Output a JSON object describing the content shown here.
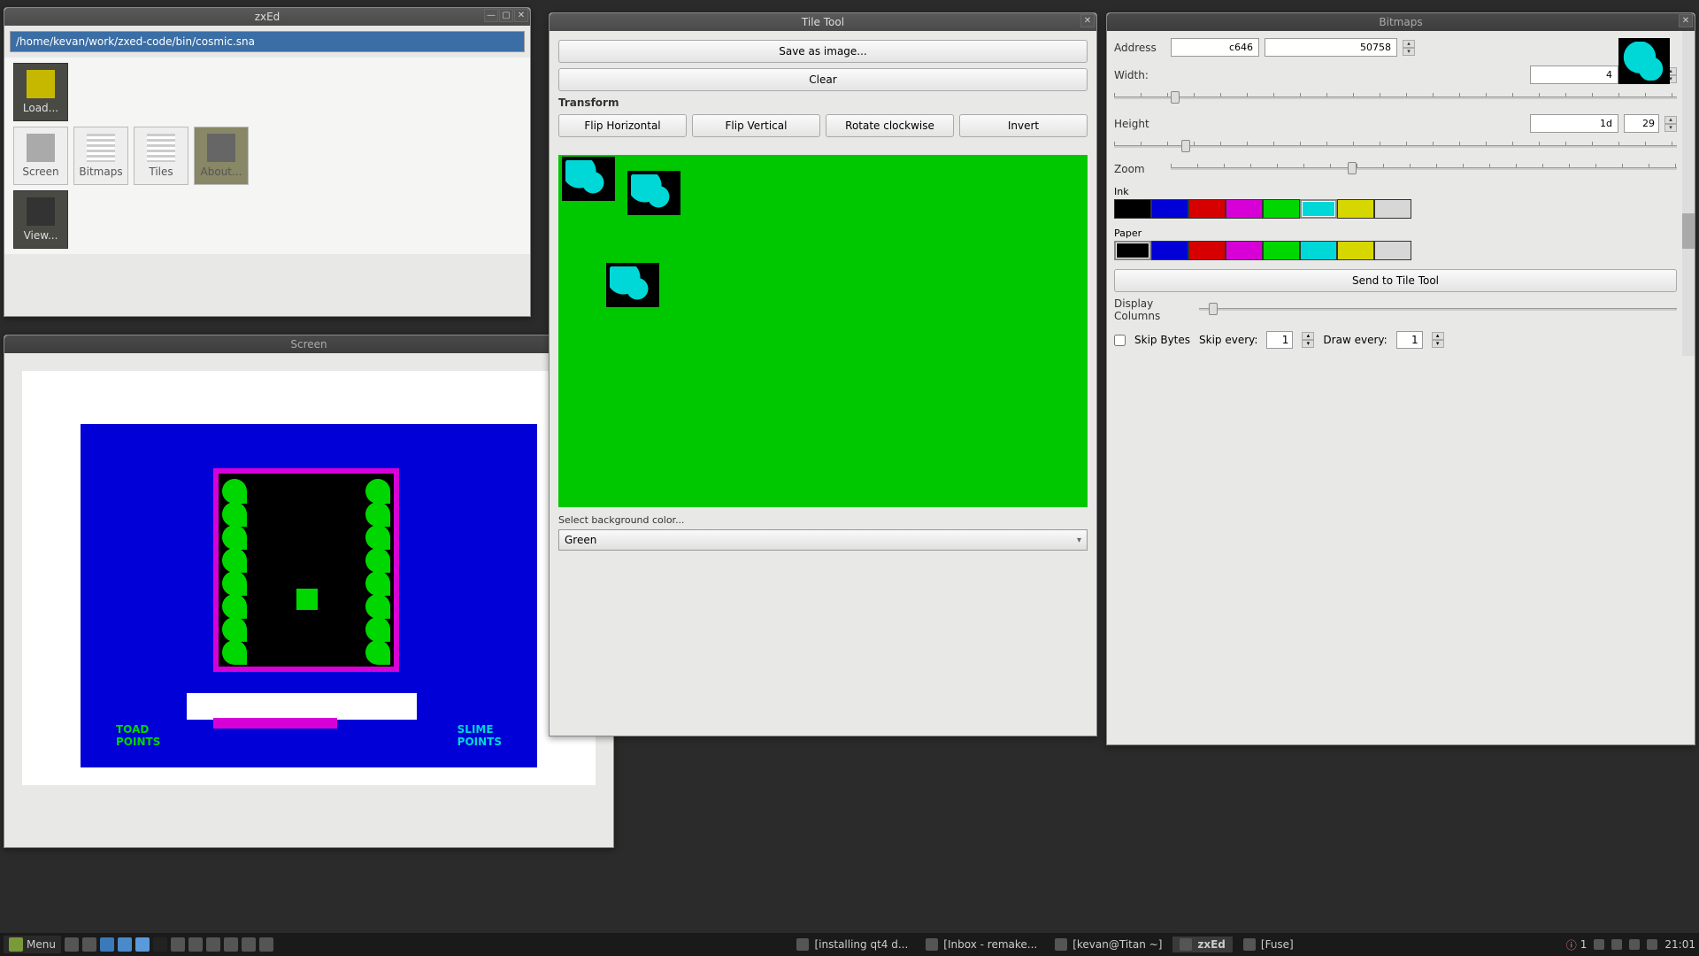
{
  "zxed": {
    "title": "zxEd",
    "path": "/home/kevan/work/zxed-code/bin/cosmic.sna",
    "tools": [
      {
        "label": "Load...",
        "dark": true,
        "yellow": true
      },
      {
        "label": "Screen"
      },
      {
        "label": "Bitmaps"
      },
      {
        "label": "Tiles"
      },
      {
        "label": "About...",
        "sel": true
      },
      {
        "label": "View...",
        "dark": true
      }
    ]
  },
  "screen": {
    "title": "Screen",
    "left_label": "TOAD\nPOINTS",
    "right_label": "SLIME\nPOINTS"
  },
  "tiletool": {
    "title": "Tile Tool",
    "save_btn": "Save as image...",
    "clear_btn": "Clear",
    "transform_label": "Transform",
    "flip_h": "Flip Horizontal",
    "flip_v": "Flip Vertical",
    "rotate": "Rotate clockwise",
    "invert": "Invert",
    "bg_label": "Select background color...",
    "bg_value": "Green"
  },
  "bitmaps": {
    "title": "Bitmaps",
    "address_label": "Address",
    "address_hex": "c646",
    "address_dec": "50758",
    "width_label": "Width:",
    "width_hex": "4",
    "width_dec": "4",
    "height_label": "Height",
    "height_hex": "1d",
    "height_dec": "29",
    "zoom_label": "Zoom",
    "ink_label": "Ink",
    "paper_label": "Paper",
    "send_btn": "Send to Tile Tool",
    "disp_cols_label": "Display Columns",
    "skip_bytes_label": "Skip Bytes",
    "skip_every_label": "Skip every:",
    "skip_every_val": "1",
    "draw_every_label": "Draw every:",
    "draw_every_val": "1",
    "palette": [
      "#000000",
      "#0000d7",
      "#d70000",
      "#d700d7",
      "#00d700",
      "#00d7d7",
      "#d7d700",
      "#d7d7d7"
    ],
    "ink_selected": 5,
    "paper_selected": 0
  },
  "taskbar": {
    "menu": "Menu",
    "notif_count": "1",
    "tasks": [
      {
        "label": "[installing qt4 d...",
        "active": false
      },
      {
        "label": "[Inbox - remake...",
        "active": false
      },
      {
        "label": "[kevan@Titan ~]",
        "active": false
      },
      {
        "label": "zxEd",
        "active": true
      },
      {
        "label": "[Fuse]",
        "active": false
      }
    ],
    "clock": "21:01"
  }
}
